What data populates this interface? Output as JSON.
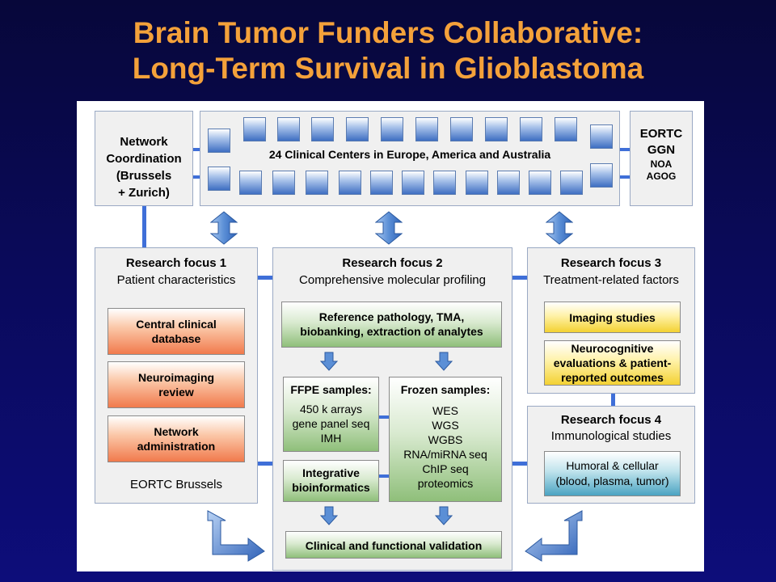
{
  "title": {
    "line1": "Brain Tumor Funders Collaborative:",
    "line2": "Long-Term Survival in Glioblastoma"
  },
  "network": {
    "line1": "Network",
    "line2": "Coordination",
    "line3": "(Brussels",
    "line4": "+ Zurich)"
  },
  "centers": {
    "label": "24 Clinical Centers in Europe, America and Australia"
  },
  "partners": {
    "line1": "EORTC",
    "line2": "GGN",
    "line3": "NOA",
    "line4": "AGOG"
  },
  "focus1": {
    "title": "Research focus 1",
    "subtitle": "Patient characteristics",
    "items": [
      {
        "line1": "Central clinical",
        "line2": "database"
      },
      {
        "line1": "Neuroimaging",
        "line2": "review"
      },
      {
        "line1": "Network",
        "line2": "administration"
      }
    ],
    "footer": "EORTC Brussels"
  },
  "focus2": {
    "title": "Research focus 2",
    "subtitle": "Comprehensive molecular profiling",
    "reference": {
      "line1": "Reference pathology, TMA,",
      "line2": "biobanking, extraction of analytes"
    },
    "ffpe": {
      "header": "FFPE samples:",
      "lines": [
        "450 k arrays",
        "gene panel seq",
        "IMH"
      ]
    },
    "frozen": {
      "header": "Frozen samples:",
      "lines": [
        "WES",
        "WGS",
        "WGBS",
        "RNA/miRNA seq",
        "ChIP seq",
        "proteomics"
      ]
    },
    "integrative": {
      "line1": "Integrative",
      "line2": "bioinformatics"
    },
    "validation": "Clinical and functional validation"
  },
  "focus3": {
    "title": "Research focus 3",
    "subtitle": "Treatment-related factors",
    "imaging": "Imaging studies",
    "neuro": {
      "line1": "Neurocognitive",
      "line2": "evaluations & patient-",
      "line3": "reported outcomes"
    }
  },
  "focus4": {
    "title": "Research focus 4",
    "subtitle": "Immunological studies",
    "humoral": {
      "line1": "Humoral & cellular",
      "line2": "(blood, plasma, tumor)"
    }
  },
  "colors": {
    "title": "#f4a13a",
    "connector": "#3f6fd8",
    "orange_box": "#f17a4c",
    "green_box": "#8fbf7a",
    "yellow_box": "#f3d132",
    "blue_box": "#4aa3c2",
    "arrow": "#5b8fd6"
  },
  "icons": {
    "double_arrow": "vertical-double-arrow-icon",
    "down_arrow": "down-arrow-icon",
    "bent_arrow": "bent-arrow-icon",
    "center": "clinical-center-square-icon"
  }
}
